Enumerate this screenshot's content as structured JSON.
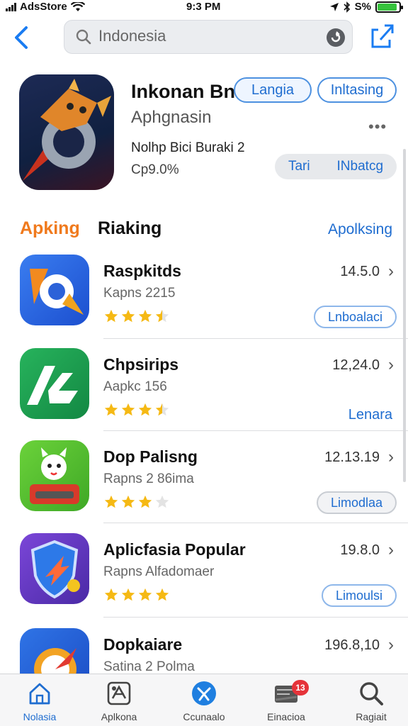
{
  "status_bar": {
    "carrier": "AdsStore",
    "time": "9:3 PM",
    "battery": "S%",
    "battery_level": 0.9
  },
  "nav": {
    "back_icon": "chevron-left-icon",
    "search": {
      "value": "Indonesia",
      "placeholder": "Indonesia"
    },
    "share_icon": "share-icon"
  },
  "featured": {
    "title": "Inkonan Bn",
    "subtitle": "Aphgnasin",
    "meta": "Nolhp Bici Buraki 2",
    "percent": "Cp9.0%",
    "lang_button": "Langia",
    "install_button": "Inltasing",
    "segments": [
      "Tari",
      "INbatcg"
    ]
  },
  "section": {
    "title_accent": "Apking",
    "title_rest": "Riaking",
    "link": "Apolksing"
  },
  "apps": [
    {
      "name": "Raspkitds",
      "sub": "Kapns 2215",
      "version": "14.5.0",
      "rating": 3.5,
      "action": "Lnboalaci",
      "action_style": "outline"
    },
    {
      "name": "Chpsirips",
      "sub": "Aapkc 156",
      "version": "12,24.0",
      "rating": 3.5,
      "action": "Lenara",
      "action_style": "text"
    },
    {
      "name": "Dop Palisng",
      "sub": "Rapns 2 86ima",
      "version": "12.13.19",
      "rating": 3.0,
      "action": "Limodlaa",
      "action_style": "gray"
    },
    {
      "name": "Aplicfasia Popular",
      "sub": "Rapns Alfadomaer",
      "version": "19.8.0",
      "rating": 4.0,
      "action": "Limoulsi",
      "action_style": "outline"
    },
    {
      "name": "Dopkaiare",
      "sub": "Satina 2 Polma",
      "version": "196.8,10",
      "rating": 0,
      "action": "",
      "action_style": "none"
    }
  ],
  "tabs": [
    {
      "label": "Nolasia",
      "icon": "home-icon",
      "active": true
    },
    {
      "label": "Aplkona",
      "icon": "apps-icon",
      "active": false
    },
    {
      "label": "Ccunaalo",
      "icon": "games-icon",
      "active": false
    },
    {
      "label": "Einacioa",
      "icon": "updates-icon",
      "active": false,
      "badge": "13"
    },
    {
      "label": "Ragiait",
      "icon": "search-icon",
      "active": false
    }
  ],
  "colors": {
    "accent": "#1f6dd0",
    "section_accent": "#f07a1d",
    "star": "#f5b914",
    "badge": "#e5333a"
  }
}
